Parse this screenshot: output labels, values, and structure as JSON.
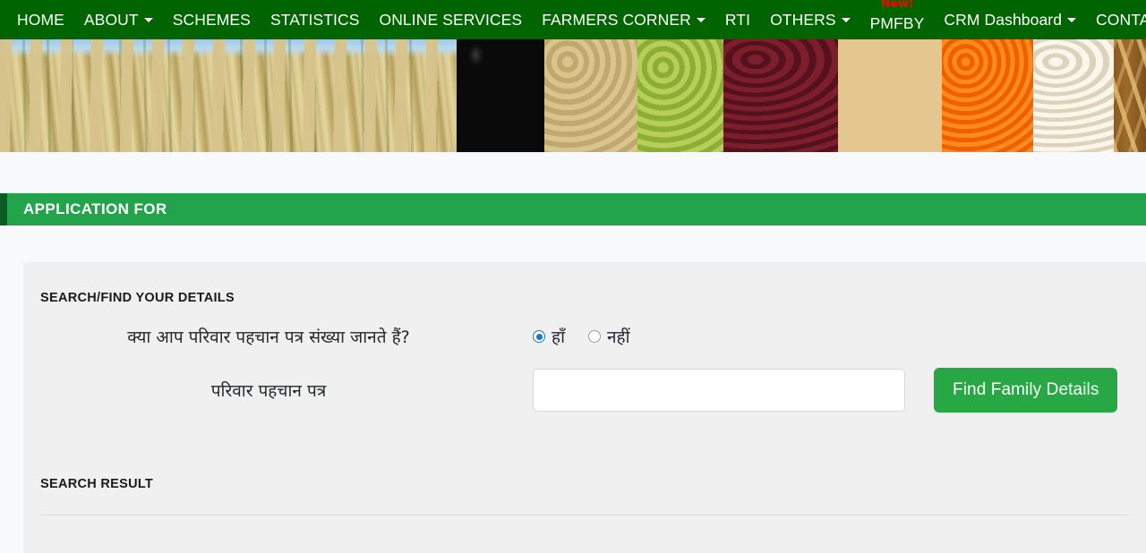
{
  "nav": {
    "items": [
      {
        "label": "HOME",
        "caret": false,
        "badge": null
      },
      {
        "label": "ABOUT",
        "caret": true,
        "badge": null
      },
      {
        "label": "SCHEMES",
        "caret": false,
        "badge": null
      },
      {
        "label": "STATISTICS",
        "caret": false,
        "badge": null
      },
      {
        "label": "ONLINE SERVICES",
        "caret": false,
        "badge": null
      },
      {
        "label": "FARMERS CORNER",
        "caret": true,
        "badge": null
      },
      {
        "label": "RTI",
        "caret": false,
        "badge": null
      },
      {
        "label": "OTHERS",
        "caret": true,
        "badge": null
      },
      {
        "label": "PMFBY",
        "caret": false,
        "badge": "New!"
      },
      {
        "label": "CRM Dashboard",
        "caret": true,
        "badge": null
      },
      {
        "label": "CONTACT US",
        "caret": false,
        "badge": null
      }
    ]
  },
  "banner": {
    "alt": "crops-and-pulses-banner",
    "bands": [
      "pearl-millet-field",
      "black-beans",
      "tan-lentils",
      "green-split-peas",
      "red-kidney-beans",
      "chickpeas",
      "orange-lentils",
      "white-beans",
      "wheat-stalks"
    ]
  },
  "section": {
    "title": "APPLICATION FOR"
  },
  "form": {
    "title": "SEARCH/FIND YOUR DETAILS",
    "question_label": "क्या आप परिवार पहचान पत्र संख्या जानते हैं?",
    "options": [
      {
        "label": "हाँ",
        "selected": true
      },
      {
        "label": "नहीं",
        "selected": false
      }
    ],
    "ppp_label": "परिवार पहचान पत्र",
    "ppp_value": "",
    "ppp_placeholder": "",
    "submit_label": "Find Family Details"
  },
  "result": {
    "title": "SEARCH RESULT"
  },
  "colors": {
    "nav_green": "#006400",
    "section_green": "#22a44c",
    "section_green_dark": "#0d5c22",
    "button_green": "#27a844",
    "badge_red": "#ff0000",
    "radio_blue": "#1577d4",
    "card_gray": "#f0f0f0",
    "page_bg": "#f8f9fb"
  }
}
